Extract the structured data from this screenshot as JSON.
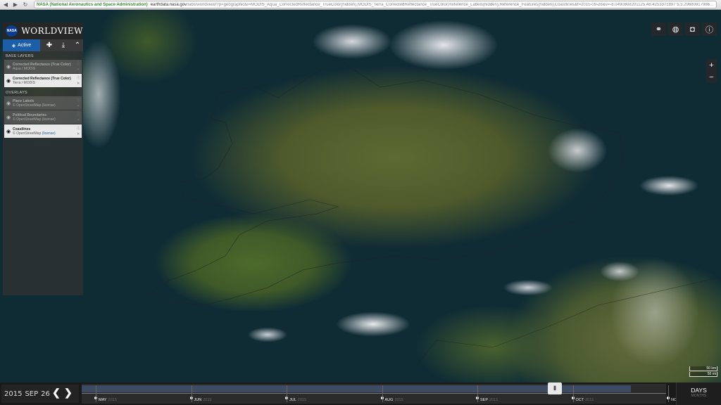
{
  "browser": {
    "url_org": "NASA (National Aeronautics and Space Administration)",
    "url_host": "earthdata.nasa.gov",
    "url_path": "/labs/worldview/?p=geographic&l=MODIS_Aqua_CorrectedReflectance_TrueColor(hidden),MODIS_Terra_CorrectedReflectance_TrueColor,Reference_Labels(hidden),Reference_Features(hidden),Coastlines&t=2015-09-26&v=-8.0490808201125,48.4253371897 5,3.29680917986875,54.577868659375 ~ 1&ab..."
  },
  "brand": {
    "logo": "NASA",
    "title": "WORLDVIEW"
  },
  "tabs": {
    "active_label": "Active"
  },
  "sections": {
    "base_layers": "BASE LAYERS",
    "overlays": "OVERLAYS"
  },
  "base_layers": [
    {
      "title": "Corrected Reflectance (True Color)",
      "sub": "Aqua / MODIS",
      "visible": false
    },
    {
      "title": "Corrected Reflectance (True Color)",
      "sub": "Terra / MODIS",
      "visible": true
    }
  ],
  "overlays": [
    {
      "title": "Place Labels",
      "sub": "© OpenStreetMap (license)",
      "visible": false
    },
    {
      "title": "Political Boundaries",
      "sub": "© OpenStreetMap (license)",
      "visible": false
    },
    {
      "title": "Coastlines",
      "sub": "© OpenStreetMap",
      "link": "(license)",
      "visible": true
    }
  ],
  "toolbar_icons": [
    "link-icon",
    "globe-icon",
    "camera-icon",
    "info-icon"
  ],
  "zoom": {
    "in": "+",
    "out": "−"
  },
  "scale": {
    "km": "50 km",
    "mi": "50 mi"
  },
  "date": {
    "year": "2015",
    "month": "SEP",
    "day": "26"
  },
  "timeline": {
    "months": [
      {
        "label": "MAY",
        "year": "2015"
      },
      {
        "label": "JUN",
        "year": "2015"
      },
      {
        "label": "JUL",
        "year": "2015"
      },
      {
        "label": "AUG",
        "year": "2015"
      },
      {
        "label": "SEP",
        "year": "2015"
      },
      {
        "label": "OCT",
        "year": "2015"
      },
      {
        "label": "NOV",
        "year": "2015"
      }
    ],
    "zoom_main": "DAYS",
    "zoom_sub": "MONTHS"
  }
}
